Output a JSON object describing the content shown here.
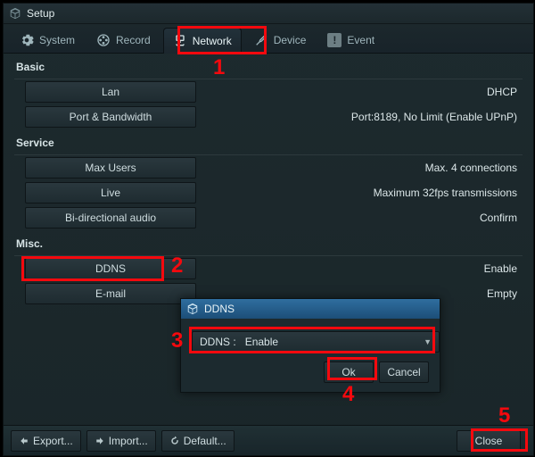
{
  "window": {
    "title": "Setup"
  },
  "tabs": {
    "system": "System",
    "record": "Record",
    "network": "Network",
    "device": "Device",
    "event": "Event"
  },
  "sections": {
    "basic": {
      "header": "Basic",
      "lan": {
        "label": "Lan",
        "value": "DHCP"
      },
      "portbw": {
        "label": "Port & Bandwidth",
        "value": "Port:8189, No Limit (Enable UPnP)"
      }
    },
    "service": {
      "header": "Service",
      "maxusers": {
        "label": "Max Users",
        "value": "Max. 4 connections"
      },
      "live": {
        "label": "Live",
        "value": "Maximum 32fps transmissions"
      },
      "biaudio": {
        "label": "Bi-directional audio",
        "value": "Confirm"
      }
    },
    "misc": {
      "header": "Misc.",
      "ddns": {
        "label": "DDNS",
        "value": "Enable"
      },
      "email": {
        "label": "E-mail",
        "value": "Empty"
      }
    }
  },
  "footer": {
    "export": "Export...",
    "import": "Import...",
    "default": "Default...",
    "close": "Close"
  },
  "dialog": {
    "title": "DDNS",
    "field_label": "DDNS :",
    "field_value": "Enable",
    "ok": "Ok",
    "cancel": "Cancel"
  },
  "annotations": {
    "n1": "1",
    "n2": "2",
    "n3": "3",
    "n4": "4",
    "n5": "5"
  }
}
